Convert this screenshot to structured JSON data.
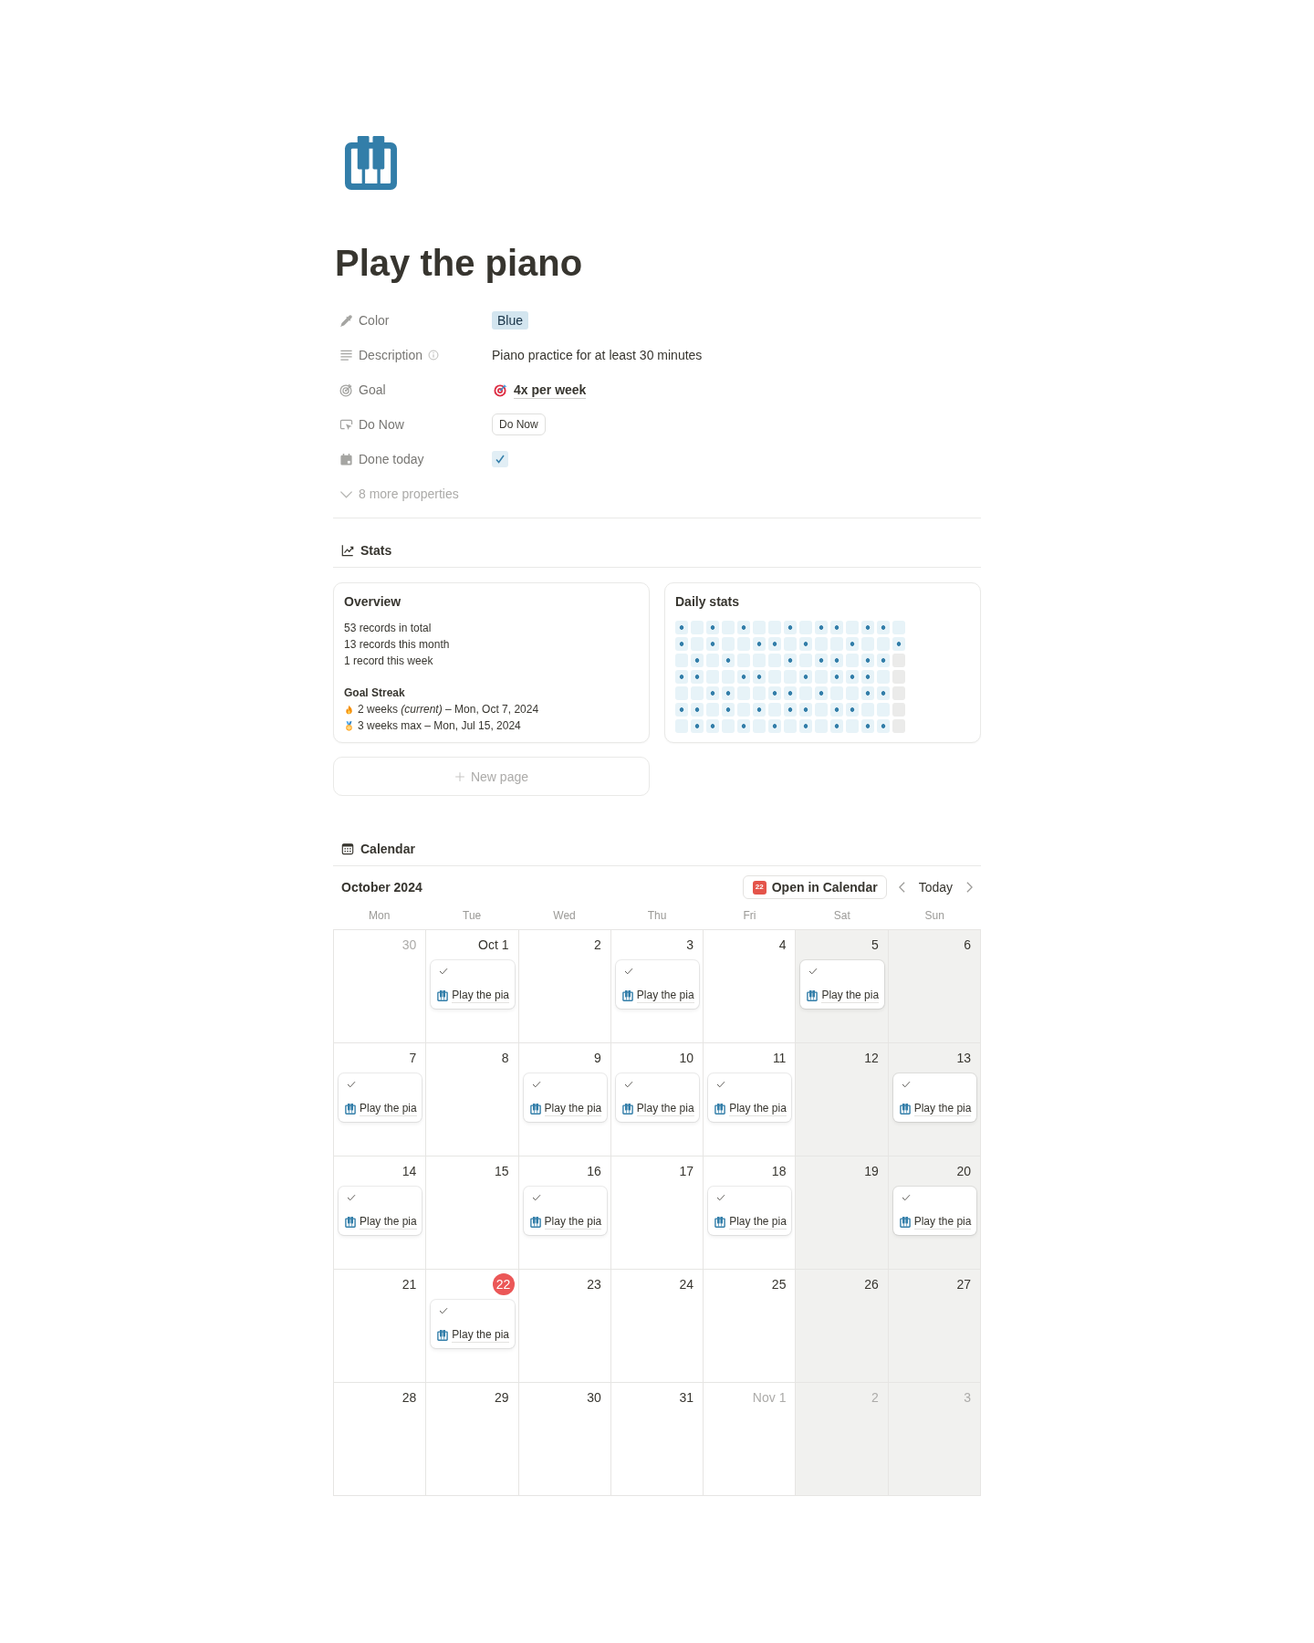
{
  "page": {
    "title": "Play the piano"
  },
  "properties": [
    {
      "label": "Color",
      "info": false,
      "kind": "tag",
      "value": "Blue"
    },
    {
      "label": "Description",
      "info": true,
      "kind": "text",
      "value": "Piano practice for at least 30 minutes"
    },
    {
      "label": "Goal",
      "info": false,
      "kind": "relation",
      "value": "4x per week"
    },
    {
      "label": "Do Now",
      "info": false,
      "kind": "button",
      "value": "Do Now"
    },
    {
      "label": "Done today",
      "info": false,
      "kind": "checkbox",
      "checked": true
    }
  ],
  "more_properties": "8 more properties",
  "stats": {
    "view": "Stats",
    "overview": {
      "title": "Overview",
      "lines": [
        "53 records in total",
        "13 records this month",
        "1 record this week"
      ],
      "streak_title": "Goal Streak",
      "streaks": [
        {
          "kind": "current",
          "text": "2 weeks *(current)* – Mon, Oct 7, 2024"
        },
        {
          "kind": "max",
          "text": "3 weeks max – Mon, Jul 15, 2024"
        }
      ]
    },
    "daily_stats": {
      "title": "Daily stats",
      "rows": [
        {
          "cells": [
            {
              "kind": "done"
            },
            {
              "kind": "missed"
            },
            {
              "kind": "done"
            },
            {
              "kind": "missed"
            },
            {
              "kind": "done"
            },
            {
              "kind": "missed"
            },
            {
              "kind": "missed"
            },
            {
              "kind": "done"
            },
            {
              "kind": "missed"
            },
            {
              "kind": "done"
            },
            {
              "kind": "done"
            },
            {
              "kind": "missed"
            },
            {
              "kind": "done"
            },
            {
              "kind": "done"
            },
            {
              "kind": "missed"
            }
          ]
        },
        {
          "cells": [
            {
              "kind": "done"
            },
            {
              "kind": "missed"
            },
            {
              "kind": "done"
            },
            {
              "kind": "missed"
            },
            {
              "kind": "missed"
            },
            {
              "kind": "done"
            },
            {
              "kind": "done"
            },
            {
              "kind": "missed"
            },
            {
              "kind": "done"
            },
            {
              "kind": "missed"
            },
            {
              "kind": "missed"
            },
            {
              "kind": "done"
            },
            {
              "kind": "missed"
            },
            {
              "kind": "missed"
            },
            {
              "kind": "done"
            }
          ]
        },
        {
          "cells": [
            {
              "kind": "missed"
            },
            {
              "kind": "done"
            },
            {
              "kind": "missed"
            },
            {
              "kind": "done"
            },
            {
              "kind": "missed"
            },
            {
              "kind": "missed"
            },
            {
              "kind": "missed"
            },
            {
              "kind": "done"
            },
            {
              "kind": "missed"
            },
            {
              "kind": "done"
            },
            {
              "kind": "done"
            },
            {
              "kind": "missed"
            },
            {
              "kind": "done"
            },
            {
              "kind": "done"
            },
            {
              "kind": "future"
            }
          ]
        },
        {
          "cells": [
            {
              "kind": "done"
            },
            {
              "kind": "done"
            },
            {
              "kind": "missed"
            },
            {
              "kind": "missed"
            },
            {
              "kind": "done"
            },
            {
              "kind": "done"
            },
            {
              "kind": "missed"
            },
            {
              "kind": "missed"
            },
            {
              "kind": "done"
            },
            {
              "kind": "missed"
            },
            {
              "kind": "done"
            },
            {
              "kind": "done"
            },
            {
              "kind": "done"
            },
            {
              "kind": "missed"
            },
            {
              "kind": "future"
            }
          ]
        },
        {
          "cells": [
            {
              "kind": "missed"
            },
            {
              "kind": "missed"
            },
            {
              "kind": "done"
            },
            {
              "kind": "done"
            },
            {
              "kind": "missed"
            },
            {
              "kind": "missed"
            },
            {
              "kind": "done"
            },
            {
              "kind": "done"
            },
            {
              "kind": "missed"
            },
            {
              "kind": "done"
            },
            {
              "kind": "missed"
            },
            {
              "kind": "missed"
            },
            {
              "kind": "done"
            },
            {
              "kind": "done"
            },
            {
              "kind": "future"
            }
          ]
        },
        {
          "cells": [
            {
              "kind": "done"
            },
            {
              "kind": "done"
            },
            {
              "kind": "missed"
            },
            {
              "kind": "done"
            },
            {
              "kind": "missed"
            },
            {
              "kind": "done"
            },
            {
              "kind": "missed"
            },
            {
              "kind": "done"
            },
            {
              "kind": "done"
            },
            {
              "kind": "missed"
            },
            {
              "kind": "done"
            },
            {
              "kind": "done"
            },
            {
              "kind": "missed"
            },
            {
              "kind": "missed"
            },
            {
              "kind": "future"
            }
          ]
        },
        {
          "cells": [
            {
              "kind": "missed"
            },
            {
              "kind": "done"
            },
            {
              "kind": "done"
            },
            {
              "kind": "missed"
            },
            {
              "kind": "done"
            },
            {
              "kind": "missed"
            },
            {
              "kind": "done"
            },
            {
              "kind": "missed"
            },
            {
              "kind": "done"
            },
            {
              "kind": "missed"
            },
            {
              "kind": "done"
            },
            {
              "kind": "missed"
            },
            {
              "kind": "done"
            },
            {
              "kind": "done"
            },
            {
              "kind": "future"
            }
          ]
        }
      ]
    },
    "new_page": "New page"
  },
  "calendar": {
    "view": "Calendar",
    "month": "October 2024",
    "open_button": {
      "label": "Open in Calendar",
      "icon_date": "22"
    },
    "today_button": "Today",
    "columns": [
      {
        "label": "Mon",
        "weekend": false
      },
      {
        "label": "Tue",
        "weekend": false
      },
      {
        "label": "Wed",
        "weekend": false
      },
      {
        "label": "Thu",
        "weekend": false
      },
      {
        "label": "Fri",
        "weekend": false
      },
      {
        "label": "Sat",
        "weekend": true
      },
      {
        "label": "Sun",
        "weekend": true
      }
    ],
    "weeks": [
      {
        "days": [
          {
            "label": "30",
            "muted": true,
            "today": false
          },
          {
            "label": "Oct 1",
            "muted": false,
            "today": false,
            "events": [
              {
                "checked": true,
                "title": "Play the pia"
              }
            ]
          },
          {
            "label": "2",
            "muted": false,
            "today": false
          },
          {
            "label": "3",
            "muted": false,
            "today": false,
            "events": [
              {
                "checked": true,
                "title": "Play the pia"
              }
            ]
          },
          {
            "label": "4",
            "muted": false,
            "today": false
          },
          {
            "label": "5",
            "muted": false,
            "today": false,
            "events": [
              {
                "checked": true,
                "title": "Play the pia"
              }
            ]
          },
          {
            "label": "6",
            "muted": false,
            "today": false
          }
        ]
      },
      {
        "days": [
          {
            "label": "7",
            "muted": false,
            "today": false,
            "events": [
              {
                "checked": true,
                "title": "Play the pia"
              }
            ]
          },
          {
            "label": "8",
            "muted": false,
            "today": false
          },
          {
            "label": "9",
            "muted": false,
            "today": false,
            "events": [
              {
                "checked": true,
                "title": "Play the pia"
              }
            ]
          },
          {
            "label": "10",
            "muted": false,
            "today": false,
            "events": [
              {
                "checked": true,
                "title": "Play the pia"
              }
            ]
          },
          {
            "label": "11",
            "muted": false,
            "today": false,
            "events": [
              {
                "checked": true,
                "title": "Play the pia"
              }
            ]
          },
          {
            "label": "12",
            "muted": false,
            "today": false
          },
          {
            "label": "13",
            "muted": false,
            "today": false,
            "events": [
              {
                "checked": true,
                "title": "Play the pia"
              }
            ]
          }
        ]
      },
      {
        "days": [
          {
            "label": "14",
            "muted": false,
            "today": false,
            "events": [
              {
                "checked": true,
                "title": "Play the pia"
              }
            ]
          },
          {
            "label": "15",
            "muted": false,
            "today": false
          },
          {
            "label": "16",
            "muted": false,
            "today": false,
            "events": [
              {
                "checked": true,
                "title": "Play the pia"
              }
            ]
          },
          {
            "label": "17",
            "muted": false,
            "today": false
          },
          {
            "label": "18",
            "muted": false,
            "today": false,
            "events": [
              {
                "checked": true,
                "title": "Play the pia"
              }
            ]
          },
          {
            "label": "19",
            "muted": false,
            "today": false
          },
          {
            "label": "20",
            "muted": false,
            "today": false,
            "events": [
              {
                "checked": true,
                "title": "Play the pia"
              }
            ]
          }
        ]
      },
      {
        "days": [
          {
            "label": "21",
            "muted": false,
            "today": false
          },
          {
            "label": "22",
            "muted": false,
            "today": true,
            "events": [
              {
                "checked": true,
                "title": "Play the pia"
              }
            ]
          },
          {
            "label": "23",
            "muted": false,
            "today": false
          },
          {
            "label": "24",
            "muted": false,
            "today": false
          },
          {
            "label": "25",
            "muted": false,
            "today": false
          },
          {
            "label": "26",
            "muted": false,
            "today": false
          },
          {
            "label": "27",
            "muted": false,
            "today": false
          }
        ]
      },
      {
        "days": [
          {
            "label": "28",
            "muted": false,
            "today": false
          },
          {
            "label": "29",
            "muted": false,
            "today": false
          },
          {
            "label": "30",
            "muted": false,
            "today": false
          },
          {
            "label": "31",
            "muted": false,
            "today": false
          },
          {
            "label": "Nov 1",
            "muted": true,
            "today": false
          },
          {
            "label": "2",
            "muted": true,
            "today": false
          },
          {
            "label": "3",
            "muted": true,
            "today": false
          }
        ]
      }
    ]
  }
}
